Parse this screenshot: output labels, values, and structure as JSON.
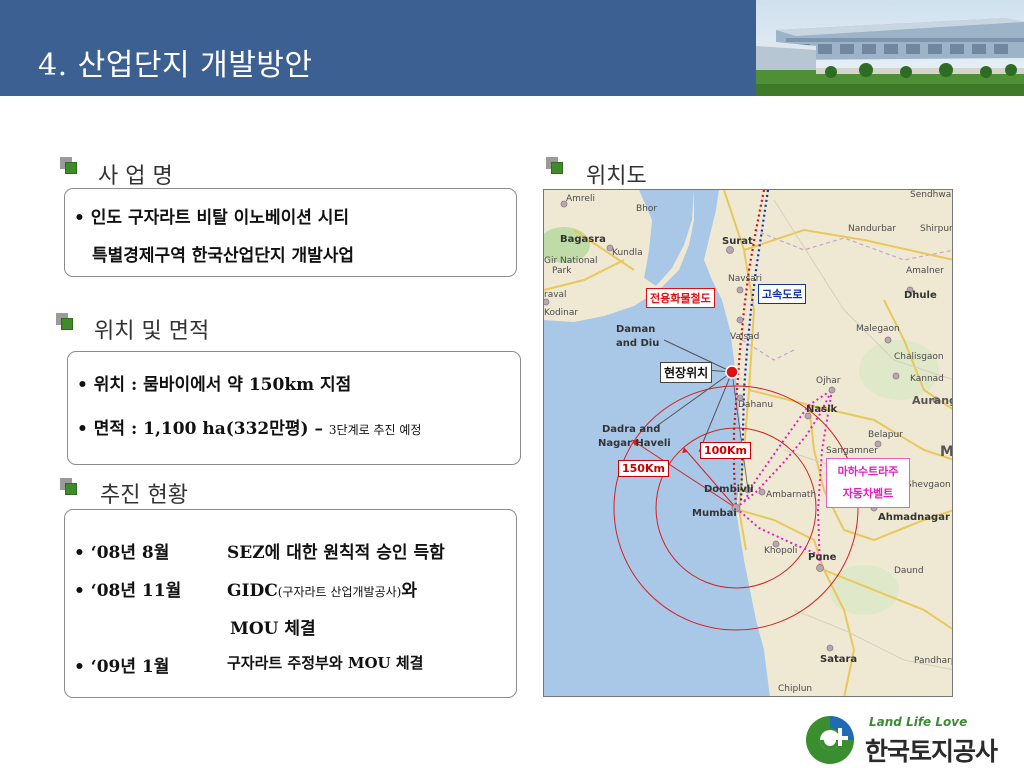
{
  "header": {
    "title_num": "4.",
    "title_text": "산업단지  개발방안"
  },
  "sections": {
    "project_name": {
      "title": "사 업 명",
      "lines": [
        "• 인도 구자라트 비탈 이노베이션 시티",
        "특별경제구역 한국산업단지 개발사업"
      ]
    },
    "location_area": {
      "title": "위치 및 면적",
      "location": "• 위치 : 뭄바이에서 약 150km 지점",
      "area_main": "• 면적 : 1,100 ha(332만평) –",
      "area_note": "3단계로 추진 예정"
    },
    "progress": {
      "title": "추진 현황",
      "rows": [
        {
          "date": "• ‘08년 8월",
          "desc": "SEZ에 대한 원칙적 승인 득함"
        },
        {
          "date": "• ‘08년 11월",
          "desc_main": "GIDC",
          "desc_small": "(구자라트 산업개발공사)",
          "desc_tail": "와"
        },
        {
          "desc": "MOU 체결"
        },
        {
          "date": "• ‘09년 1월",
          "desc": "구자라트 주정부와 MOU 체결"
        }
      ]
    },
    "map": {
      "title": "위치도",
      "tags": {
        "rail": "전용화물철도",
        "highway": "고속도로",
        "site": "현장위치",
        "r100": "100Km",
        "r150": "150Km",
        "belt_1": "마하수트라주",
        "belt_2": "자동차벨트"
      },
      "labels": {
        "amreli": "Amreli",
        "bagasra": "Bagasra",
        "kundla": "Kundla",
        "girnational": "Gir National",
        "park": "Park",
        "raval": "raval",
        "kodinar": "Kodinar",
        "surat": "Surat",
        "navsari": "Navsari",
        "valsad": "Valsad",
        "daman": "Daman",
        "anddiu": "and Diu",
        "dahanu": "Dahanu",
        "dadra": "Dadra and",
        "nagarhaveli": "Nagar Haveli",
        "dombivli": "Dombivli",
        "mumbai": "Mumbai",
        "ambarnath": "Ambarnath",
        "khopoli": "Khopoli",
        "pune": "Pune",
        "nasik": "Nasik",
        "ojhar": "Ojhar",
        "sangamner": "Sangamner",
        "ahmadnagar": "Ahmadnagar",
        "shevgaon": "Shevgaon",
        "belapur": "Belapur",
        "aurangabad": "Auranga",
        "malegaon": "Malegaon",
        "chalisgaon": "Chalisgaon",
        "kannad": "Kannad",
        "dhule": "Dhule",
        "amalner": "Amalner",
        "nandurbar": "Nandurbar",
        "shirpur": "Shirpur",
        "sendhwa": "Sendhwa",
        "satara": "Satara",
        "chiplun": "Chiplun",
        "pandharp": "Pandharp",
        "daund": "Daund",
        "bhor": "Bhor",
        "m": "M"
      }
    }
  },
  "logo": {
    "slogan": "Land Life Love",
    "name": "한국토지공사"
  },
  "colors": {
    "header_bg": "#3d6092",
    "bullet_green": "#3f8a2a",
    "rail_red": "#d11111",
    "highway_blue": "#1133aa",
    "belt_magenta": "#e020c0"
  }
}
